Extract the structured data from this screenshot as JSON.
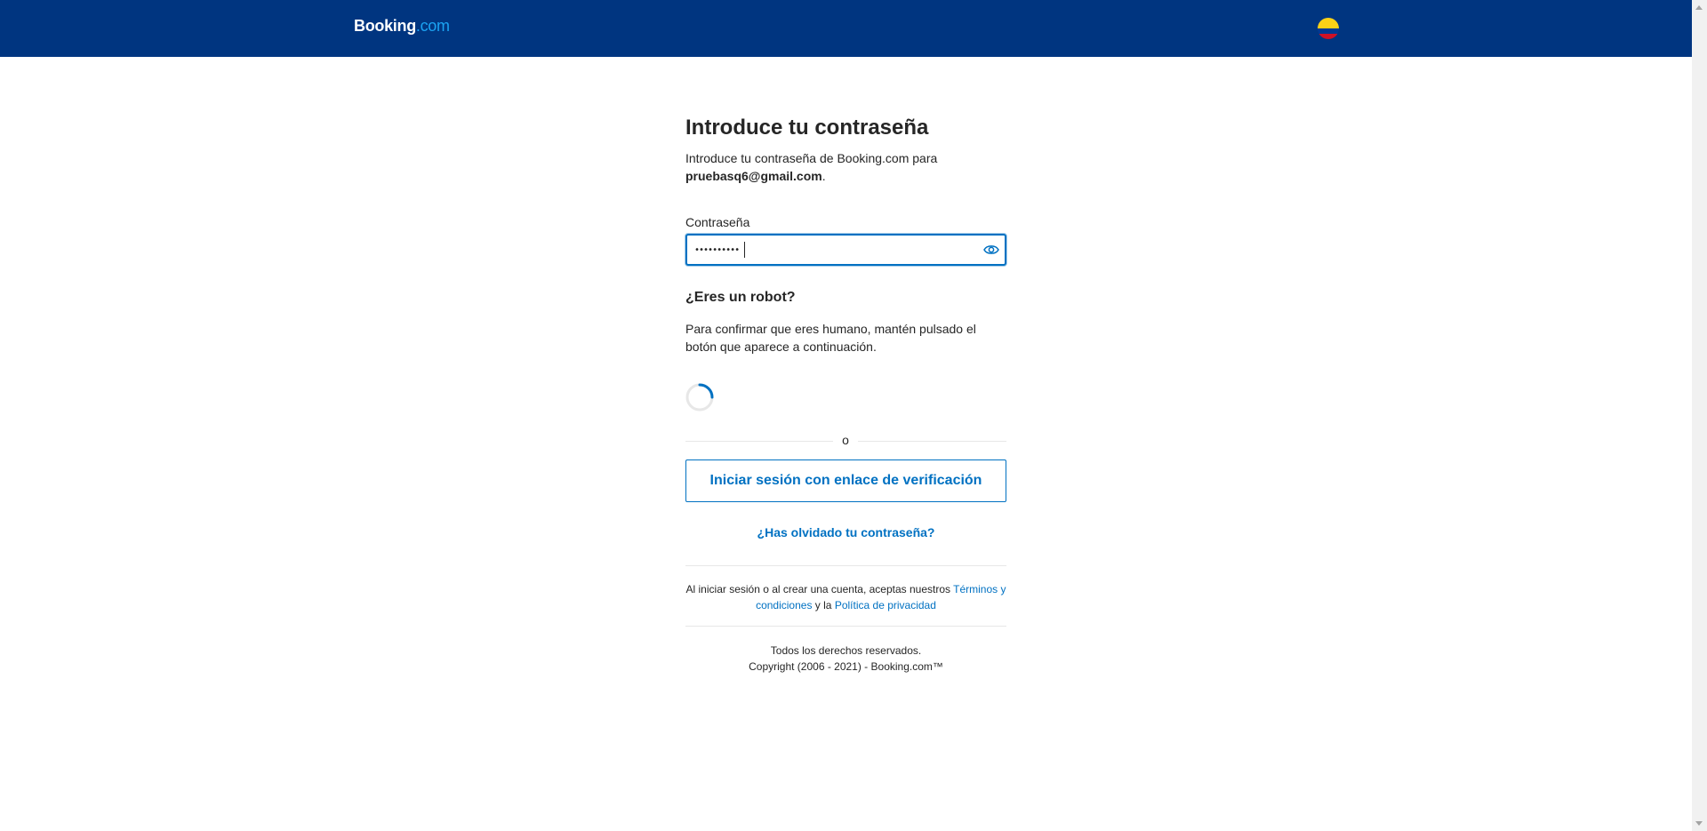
{
  "header": {
    "logo_main": "Booking",
    "logo_suffix": ".com",
    "language_flag_icon": "colombia-flag-icon"
  },
  "colors": {
    "header_bg": "#003580",
    "accent": "#0071c2",
    "logo_suffix": "#1ba3f2",
    "flag_yellow": "#fcd116",
    "flag_blue": "#003893",
    "flag_red": "#ce1126"
  },
  "page": {
    "title": "Introduce tu contraseña",
    "intro_text": "Introduce tu contraseña de Booking.com para",
    "email": "pruebasq6@gmail.com",
    "email_suffix": "."
  },
  "password": {
    "label": "Contraseña",
    "value": "••••••••••",
    "toggle_icon": "eye-icon"
  },
  "robot": {
    "title": "¿Eres un robot?",
    "text": "Para confirmar que eres humano, mantén pulsado el botón que aparece a continuación.",
    "spinner_icon": "loading-spinner-icon"
  },
  "divider_text": "o",
  "verify_link_button": "Iniciar sesión con enlace de verificación",
  "forgot_password": "¿Has olvidado tu contraseña?",
  "legal": {
    "prefix": "Al iniciar sesión o al crear una cuenta, aceptas nuestros",
    "terms_link": "Términos y condiciones",
    "and": "y la",
    "privacy_link": "Política de privacidad"
  },
  "footer": {
    "rights": "Todos los derechos reservados.",
    "copyright": "Copyright (2006 - 2021) - Booking.com™"
  }
}
